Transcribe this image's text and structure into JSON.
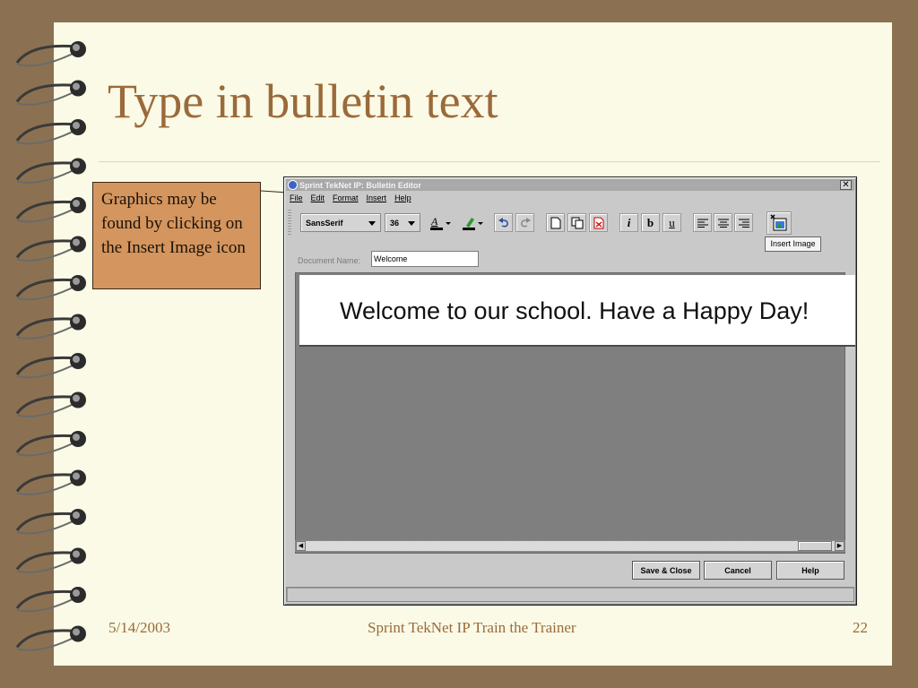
{
  "slide": {
    "title": "Type in bulletin text",
    "callout": "Graphics may be found by clicking on the Insert Image icon",
    "footer_date": "5/14/2003",
    "footer_center": "Sprint TekNet IP Train the Trainer",
    "page_number": "22"
  },
  "app": {
    "window_title": "Sprint TekNet IP: Bulletin Editor",
    "close_glyph": "✕",
    "menus": [
      "File",
      "Edit",
      "Format",
      "Insert",
      "Help"
    ],
    "font_family_value": "SansSerif",
    "font_size_value": "36",
    "toolbar_icons": {
      "text_color": "text-color-icon",
      "highlight": "highlight-pen-icon",
      "undo": "undo-icon",
      "redo": "redo-icon",
      "new_doc": "new-document-icon",
      "copy_doc": "copy-document-icon",
      "delete_doc": "delete-document-icon",
      "insert_image": "insert-image-icon"
    },
    "italic_label": "i",
    "bold_label": "b",
    "underline_label": "u",
    "tooltip": "Insert Image",
    "document_name_label": "Document Name:",
    "document_name_value": "Welcome",
    "bulletin_text": "Welcome to our school. Have a Happy Day!",
    "buttons": {
      "save_close": "Save & Close",
      "cancel": "Cancel",
      "help": "Help"
    }
  },
  "colors": {
    "background": "#8b7152",
    "slide": "#fafae6",
    "title": "#9b6a3a",
    "callout": "#d4955e",
    "app_chrome": "#c9c9c9",
    "canvas": "#7f7f7f"
  }
}
